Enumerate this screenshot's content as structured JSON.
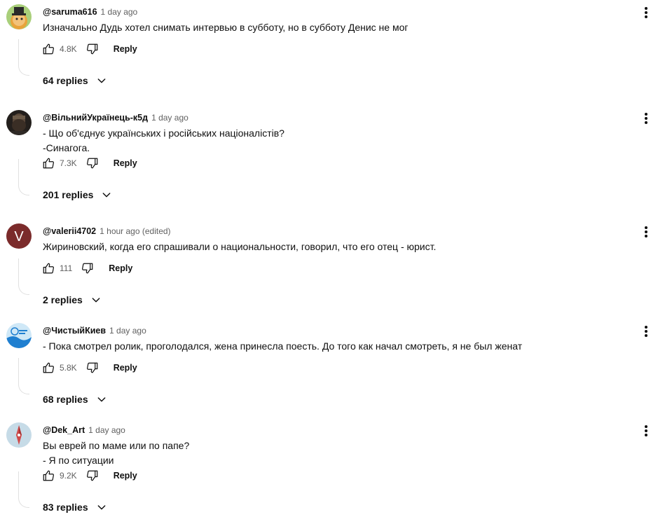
{
  "comments": [
    {
      "author": "@saruma616",
      "time": "1 day ago",
      "lines": [
        "Изначально Дудь хотел снимать интервью в субботу, но в субботу Денис не мог"
      ],
      "likes": "4.8K",
      "reply_label": "Reply",
      "replies_label": "64 replies",
      "avatar_colors": [
        "#9bc26a",
        "#e3a23a"
      ]
    },
    {
      "author": "@ВільнийУкраїнець-к5д",
      "time": "1 day ago",
      "lines": [
        "- Що об'єднує українських і російських націоналістів?",
        "-Синагога."
      ],
      "likes": "7.3K",
      "reply_label": "Reply",
      "replies_label": "201 replies",
      "avatar_colors": [
        "#2b2623",
        "#5a4a3c"
      ]
    },
    {
      "author": "@valerii4702",
      "time": "1 hour ago (edited)",
      "lines": [
        "Жириновский, когда его спрашивали о национальности, говорил, что его отец - юрист."
      ],
      "likes": "111",
      "reply_label": "Reply",
      "replies_label": "2 replies",
      "avatar_letter": "V",
      "avatar_colors": [
        "#7b2b2b",
        "#ffffff"
      ]
    },
    {
      "author": "@ЧистыйКиев",
      "time": "1 day ago",
      "lines": [
        "- Пока смотрел ролик, проголодался, жена принесла поесть. До того как начал смотреть, я не был женат"
      ],
      "likes": "5.8K",
      "reply_label": "Reply",
      "replies_label": "68 replies",
      "avatar_colors": [
        "#1f7fd0",
        "#cfe8f7"
      ]
    },
    {
      "author": "@Dek_Art",
      "time": "1 day ago",
      "lines": [
        "Вы еврей по маме или по папе?",
        "- Я по ситуации"
      ],
      "likes": "9.2K",
      "reply_label": "Reply",
      "replies_label": "83 replies",
      "avatar_colors": [
        "#c6dbe7",
        "#d04a4a"
      ]
    }
  ]
}
